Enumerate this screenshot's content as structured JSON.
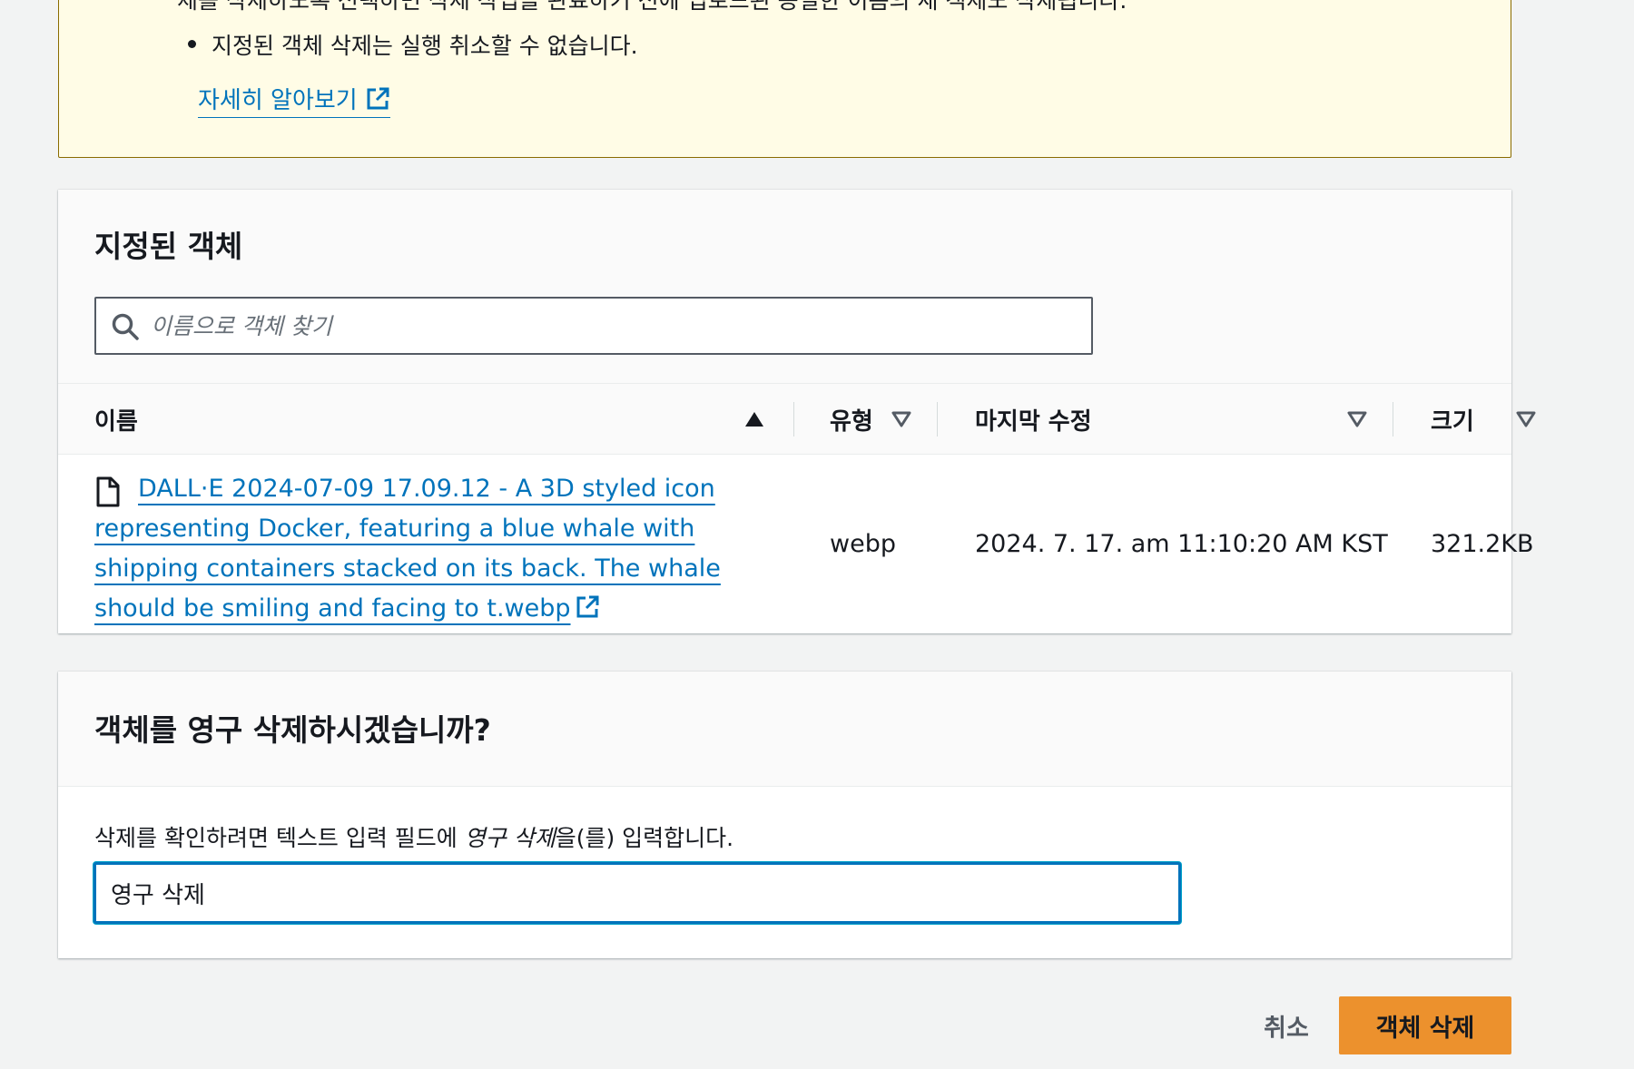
{
  "alert": {
    "cut_line": "체를 삭제하도록 선택하면 삭제 작업을 완료하기 전에 업로드된 동일한 이름의 새 객체도 삭제됩니다.",
    "bullet": "지정된 객체 삭제는 실행 취소할 수 없습니다.",
    "learn_more": "자세히 알아보기",
    "border_color": "#8a6b00",
    "background_color": "#fffce6"
  },
  "objects": {
    "title": "지정된 객체",
    "search": {
      "placeholder": "이름으로 객체 찾기",
      "value": ""
    },
    "columns": {
      "name": "이름",
      "type": "유형",
      "modified": "마지막 수정",
      "size": "크기"
    },
    "rows": [
      {
        "name": "DALL·E 2024-07-09 17.09.12 - A 3D styled icon representing Docker, featuring a blue whale with shipping containers stacked on its back. The whale should be smiling and facing to t.webp",
        "type": "webp",
        "modified": "2024. 7. 17. am 11:10:20 AM KST",
        "size": "321.2KB"
      }
    ]
  },
  "confirm": {
    "title": "객체를 영구 삭제하시겠습니까?",
    "label_prefix": "삭제를 확인하려면 텍스트 입력 필드에 ",
    "label_em": "영구 삭제",
    "label_suffix": "을(를) 입력합니다.",
    "input_value": "영구 삭제"
  },
  "footer": {
    "cancel_label": "취소",
    "delete_label": "객체 삭제"
  },
  "colors": {
    "link": "#0073bb",
    "primary_button": "#ec912d",
    "page_background": "#f2f3f3"
  }
}
